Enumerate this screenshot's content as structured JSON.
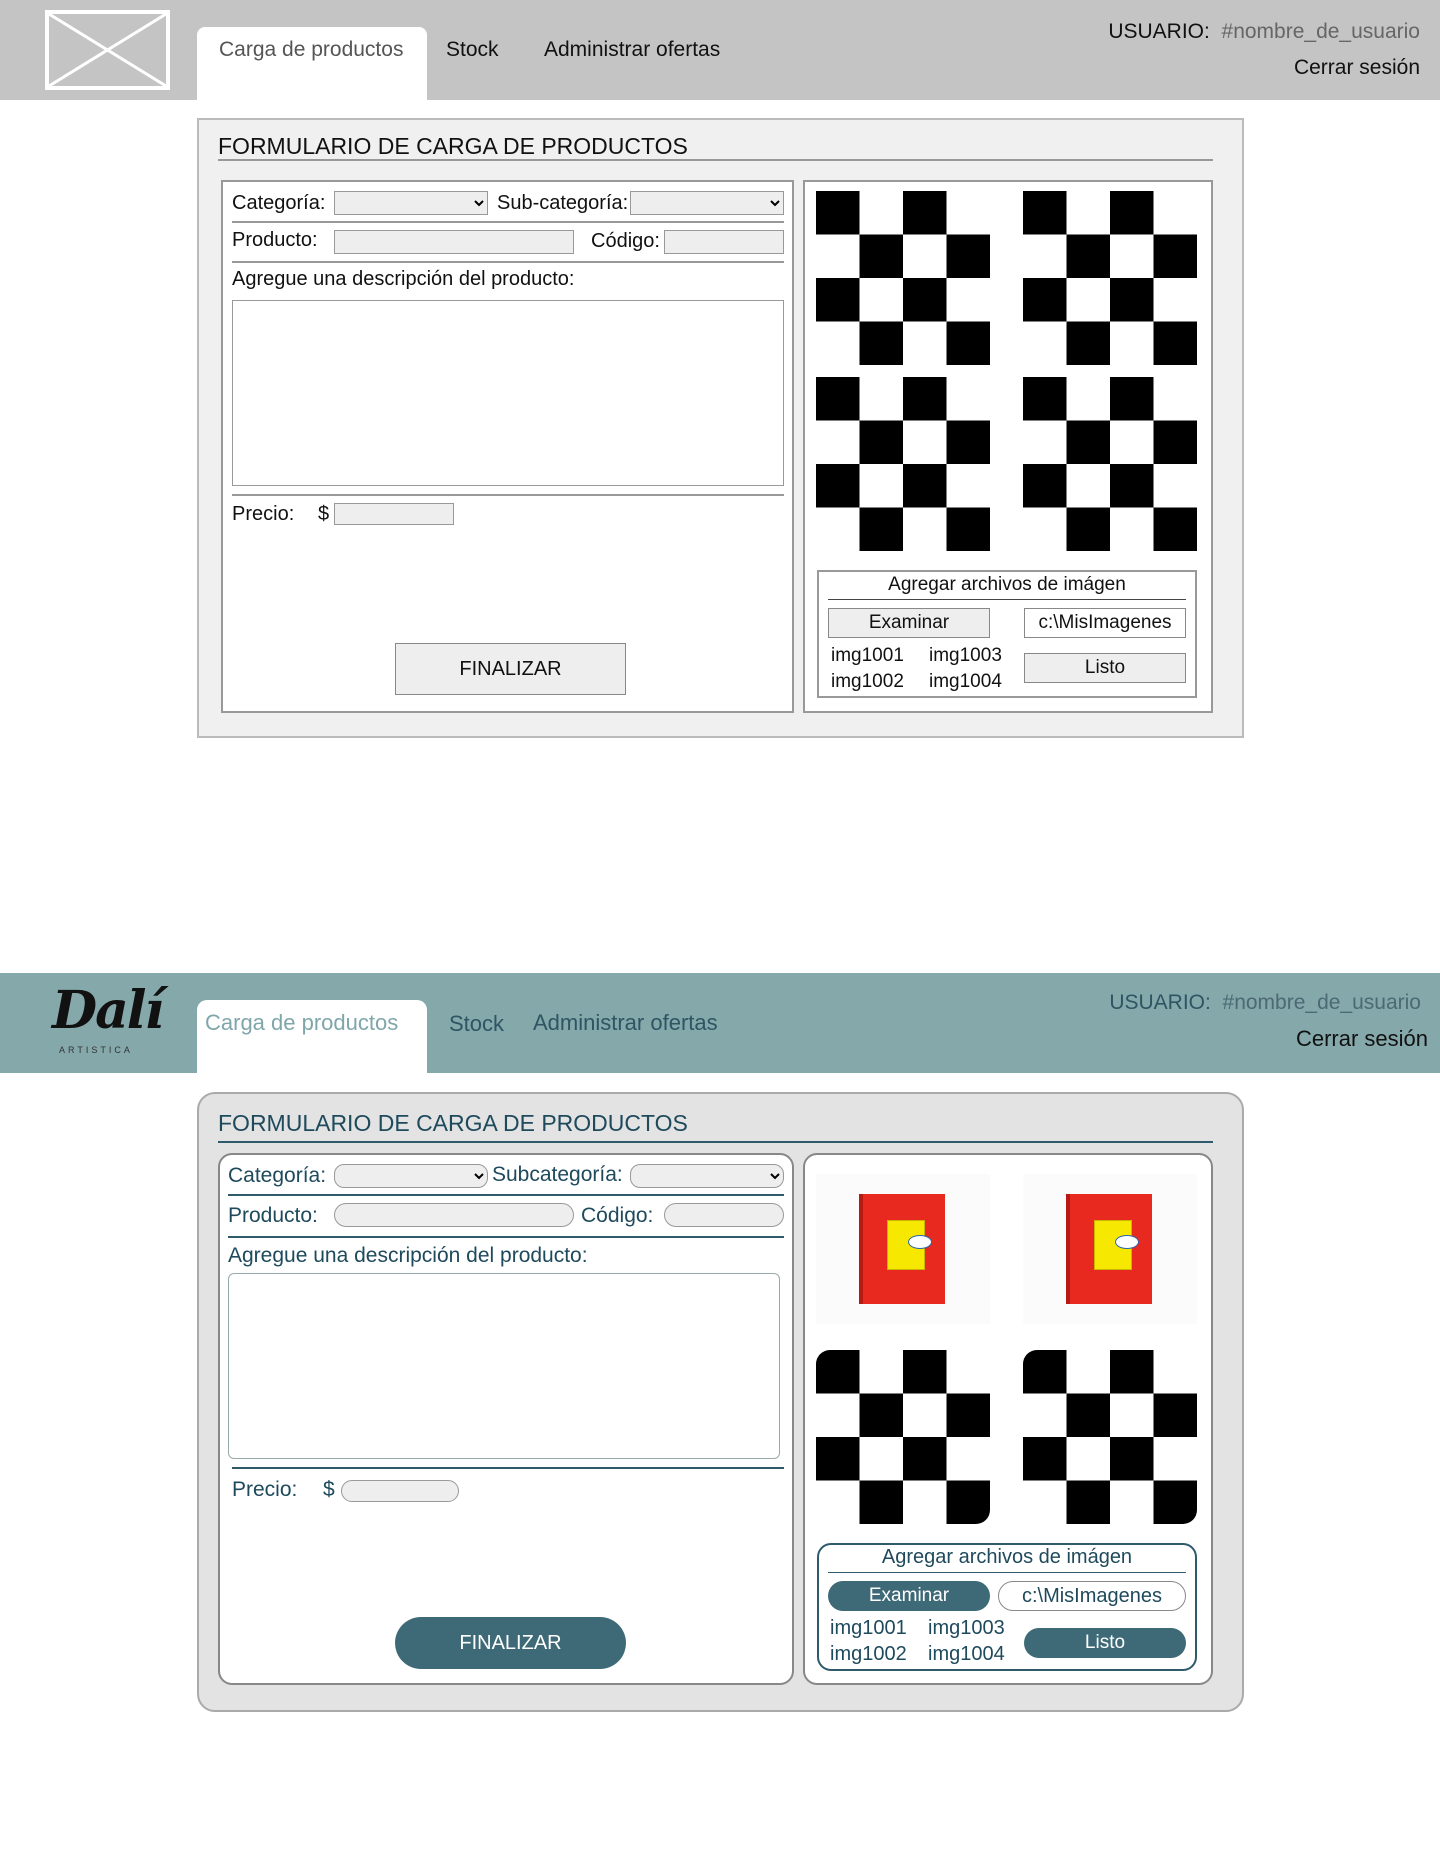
{
  "nav": {
    "tabs": [
      {
        "label": "Carga de productos",
        "active": true
      },
      {
        "label": "Stock"
      },
      {
        "label": "Administrar ofertas"
      }
    ],
    "user_label": "USUARIO:",
    "user_value": "#nombre_de_usuario",
    "logout": "Cerrar sesión"
  },
  "brand": {
    "logo_text": "Dalí",
    "logo_sub": "ARTISTICA"
  },
  "wireframe": {
    "form": {
      "title": "FORMULARIO DE CARGA DE PRODUCTOS",
      "category_label": "Categoría:",
      "subcategory_label": "Sub-categoría:",
      "product_label": "Producto:",
      "code_label": "Código:",
      "description_label": "Agregue una descripción del producto:",
      "price_label": "Precio:",
      "currency": "$",
      "submit": "FINALIZAR"
    },
    "upload": {
      "title": "Agregar archivos de imágen",
      "browse": "Examinar",
      "path": "c:\\MisImagenes",
      "done": "Listo",
      "files": [
        "img1001",
        "img1003",
        "img1002",
        "img1004"
      ]
    }
  },
  "styled": {
    "form": {
      "title": "FORMULARIO DE CARGA DE PRODUCTOS",
      "category_label": "Categoría:",
      "subcategory_label": "Subcategoría:",
      "product_label": "Producto:",
      "code_label": "Código:",
      "description_label": "Agregue una descripción del producto:",
      "price_label": "Precio:",
      "currency": "$",
      "submit": "FINALIZAR"
    },
    "upload": {
      "title": "Agregar archivos de imágen",
      "browse": "Examinar",
      "path": "c:\\MisImagenes",
      "done": "Listo",
      "files": [
        "img1001",
        "img1003",
        "img1002",
        "img1004"
      ]
    }
  },
  "colors": {
    "styled_header": "#85a8ab",
    "styled_accent": "#3e6a77",
    "wireframe_header": "#c4c4c4"
  }
}
